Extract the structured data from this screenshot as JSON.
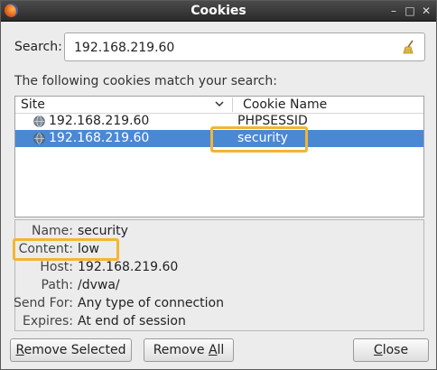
{
  "window": {
    "title": "Cookies",
    "app_icon": "firefox-icon"
  },
  "search": {
    "label": "Search:",
    "value": "192.168.219.60",
    "clear_icon": "broom-icon"
  },
  "match_label": "The following cookies match your search:",
  "tree": {
    "columns": {
      "site": "Site",
      "cookie_name": "Cookie Name"
    },
    "rows": [
      {
        "site": "192.168.219.60",
        "cookie_name": "PHPSESSID",
        "selected": false
      },
      {
        "site": "192.168.219.60",
        "cookie_name": "security",
        "selected": true
      }
    ]
  },
  "details": [
    {
      "key": "Name:",
      "value": "security"
    },
    {
      "key": "Content:",
      "value": "low"
    },
    {
      "key": "Host:",
      "value": "192.168.219.60"
    },
    {
      "key": "Path:",
      "value": "/dvwa/"
    },
    {
      "key": "Send For:",
      "value": "Any type of connection"
    },
    {
      "key": "Expires:",
      "value": "At end of session"
    }
  ],
  "buttons": {
    "remove_selected": {
      "pre": "",
      "mnemonic": "R",
      "post": "emove Selected"
    },
    "remove_all": {
      "pre": "Remove ",
      "mnemonic": "A",
      "post": "ll"
    },
    "close": {
      "pre": "",
      "mnemonic": "C",
      "post": "lose"
    }
  },
  "colors": {
    "selection": "#4a88d4",
    "highlight": "#f2b632",
    "titlebar": "#333333"
  }
}
